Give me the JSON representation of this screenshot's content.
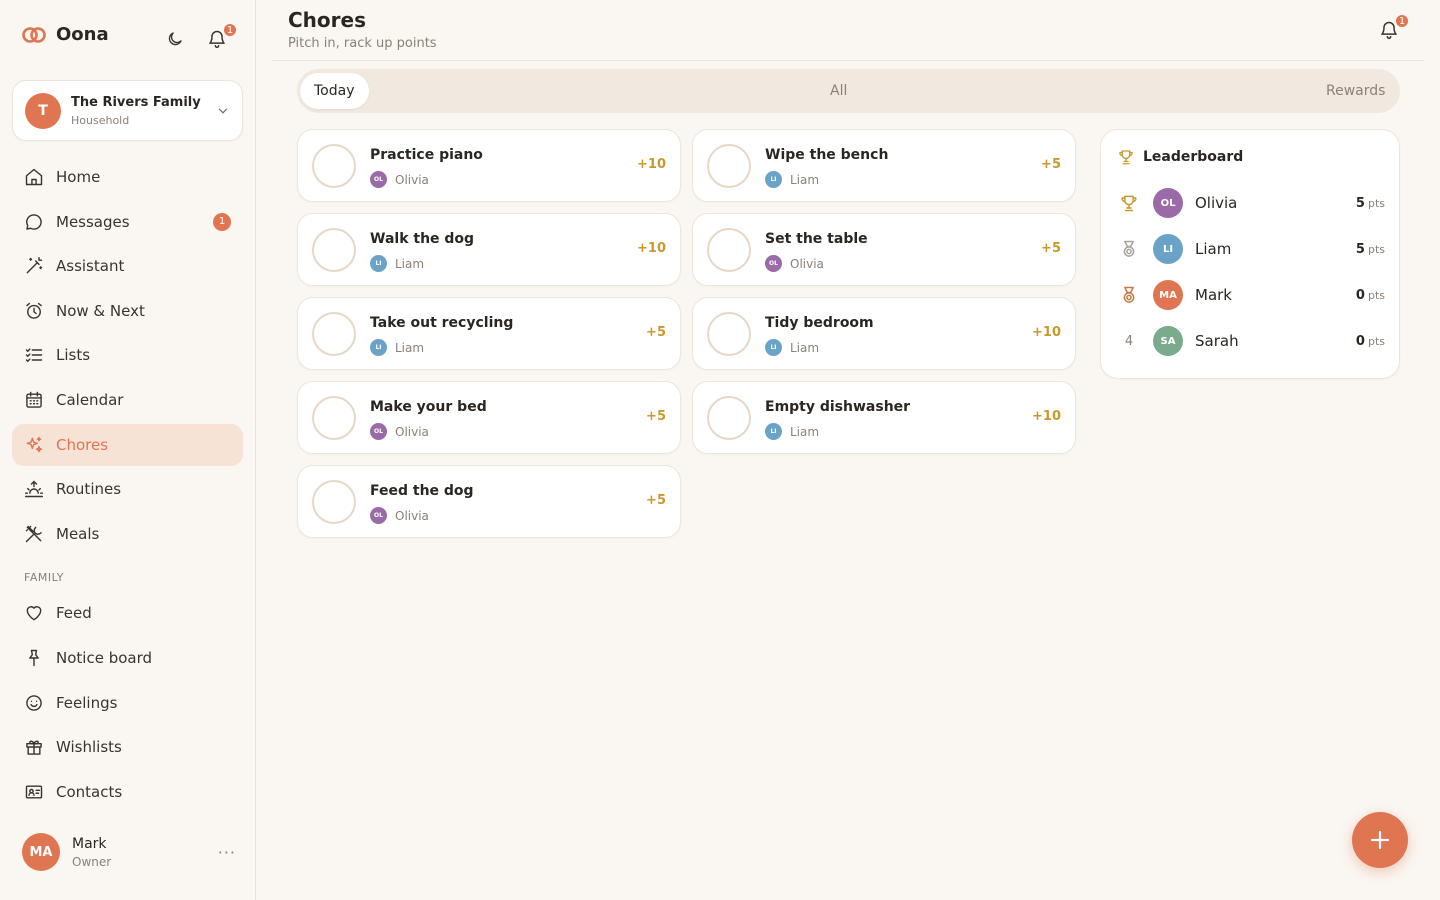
{
  "app": {
    "name": "Oona",
    "notif_count": "1"
  },
  "household": {
    "initial": "T",
    "name": "The Rivers Family",
    "type": "Household"
  },
  "nav": {
    "items": [
      {
        "label": "Home",
        "icon": "home-icon"
      },
      {
        "label": "Messages",
        "icon": "message-icon",
        "badge": "1"
      },
      {
        "label": "Assistant",
        "icon": "wand-icon"
      },
      {
        "label": "Now & Next",
        "icon": "alarm-icon"
      },
      {
        "label": "Lists",
        "icon": "checklist-icon"
      },
      {
        "label": "Calendar",
        "icon": "calendar-icon"
      },
      {
        "label": "Chores",
        "icon": "sparkle-icon",
        "active": true
      },
      {
        "label": "Routines",
        "icon": "sunrise-icon"
      },
      {
        "label": "Meals",
        "icon": "utensils-icon"
      }
    ],
    "section_family": "FAMILY",
    "family_items": [
      {
        "label": "Feed",
        "icon": "heart-icon"
      },
      {
        "label": "Notice board",
        "icon": "pin-icon"
      },
      {
        "label": "Feelings",
        "icon": "smile-icon"
      },
      {
        "label": "Wishlists",
        "icon": "gift-icon"
      },
      {
        "label": "Contacts",
        "icon": "contact-card-icon"
      }
    ]
  },
  "user": {
    "initials": "MA",
    "name": "Mark",
    "role": "Owner",
    "more": "···"
  },
  "header": {
    "title": "Chores",
    "subtitle": "Pitch in, rack up points",
    "notif_count": "1"
  },
  "tabs": {
    "today": "Today",
    "all": "All",
    "rewards": "Rewards"
  },
  "chores": [
    {
      "title": "Practice piano",
      "assignee": "Olivia",
      "initials": "OL",
      "points": "+10"
    },
    {
      "title": "Wipe the bench",
      "assignee": "Liam",
      "initials": "LI",
      "points": "+5"
    },
    {
      "title": "Walk the dog",
      "assignee": "Liam",
      "initials": "LI",
      "points": "+10"
    },
    {
      "title": "Set the table",
      "assignee": "Olivia",
      "initials": "OL",
      "points": "+5"
    },
    {
      "title": "Take out recycling",
      "assignee": "Liam",
      "initials": "LI",
      "points": "+5"
    },
    {
      "title": "Tidy bedroom",
      "assignee": "Liam",
      "initials": "LI",
      "points": "+10"
    },
    {
      "title": "Make your bed",
      "assignee": "Olivia",
      "initials": "OL",
      "points": "+5"
    },
    {
      "title": "Empty dishwasher",
      "assignee": "Liam",
      "initials": "LI",
      "points": "+10"
    },
    {
      "title": "Feed the dog",
      "assignee": "Olivia",
      "initials": "OL",
      "points": "+5"
    }
  ],
  "leaderboard": {
    "title": "Leaderboard",
    "unit": "pts",
    "rows": [
      {
        "rank_icon": "trophy-gold-icon",
        "initials": "OL",
        "name": "Olivia",
        "points": "5"
      },
      {
        "rank_icon": "medal-silver-icon",
        "initials": "LI",
        "name": "Liam",
        "points": "5"
      },
      {
        "rank_icon": "medal-bronze-icon",
        "initials": "MA",
        "name": "Mark",
        "points": "0"
      },
      {
        "rank": "4",
        "initials": "SA",
        "name": "Sarah",
        "points": "0"
      }
    ]
  },
  "colors": {
    "accent": "#e07551",
    "olivia": "#9b6ba8",
    "liam": "#6aa2c8",
    "mark": "#e07551",
    "sarah": "#7aab8c",
    "gold": "#c89a2e"
  }
}
